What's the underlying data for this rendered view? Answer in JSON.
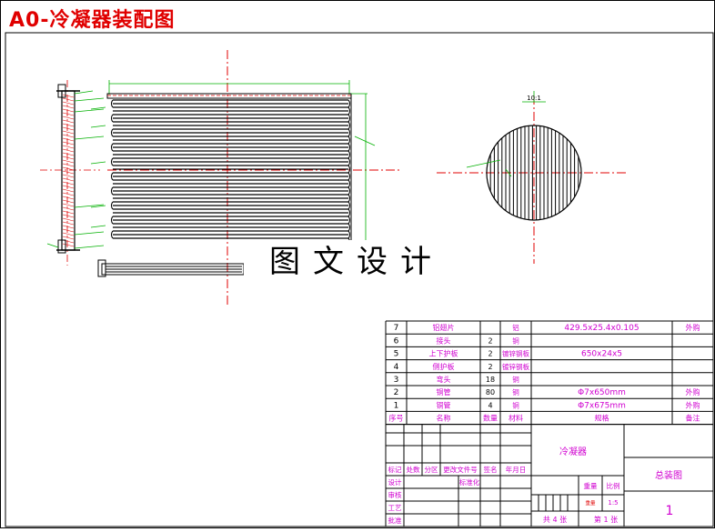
{
  "title": "A0-冷凝器装配图",
  "watermark": "图文设计",
  "detail_scale": "10:1",
  "bom": {
    "rows": [
      {
        "no": "7",
        "name": "铝翅片",
        "qty": "",
        "material": "铝",
        "spec": "429.5x25.4x0.105",
        "note": "外购"
      },
      {
        "no": "6",
        "name": "接头",
        "qty": "2",
        "material": "铜",
        "spec": "",
        "note": ""
      },
      {
        "no": "5",
        "name": "上下护板",
        "qty": "2",
        "material": "镀锌钢板",
        "spec": "650x24x5",
        "note": ""
      },
      {
        "no": "4",
        "name": "侧护板",
        "qty": "2",
        "material": "镀锌钢板",
        "spec": "",
        "note": ""
      },
      {
        "no": "3",
        "name": "弯头",
        "qty": "18",
        "material": "铜",
        "spec": "",
        "note": ""
      },
      {
        "no": "2",
        "name": "铜管",
        "qty": "80",
        "material": "铜",
        "spec": "Φ7x650mm",
        "note": "外购"
      },
      {
        "no": "1",
        "name": "铜管",
        "qty": "4",
        "material": "铜",
        "spec": "Φ7x675mm",
        "note": "外购"
      }
    ],
    "header": {
      "no": "序号",
      "name": "名称",
      "qty": "数量",
      "material": "材料",
      "spec": "规格",
      "note": "备注"
    }
  },
  "title_block": {
    "part_name": "冷凝器",
    "drawing_name": "总装图",
    "sheet_no": "1",
    "rev_labels": [
      "标记",
      "处数",
      "分区",
      "更改文件号",
      "签名",
      "年月日"
    ],
    "role_labels": [
      "设计",
      "审核",
      "工艺",
      "批准"
    ],
    "std_label": "标准化",
    "weight_label": "重量",
    "scale_label": "比例",
    "scale_value": "1:5",
    "weight_value": "",
    "mark_label": "重量",
    "total_sheets": "共  4  张",
    "this_sheet": "第  1  张"
  },
  "colors": {
    "red": "#e00000",
    "green": "#00b000",
    "magenta": "#d000d0",
    "black": "#000000"
  }
}
